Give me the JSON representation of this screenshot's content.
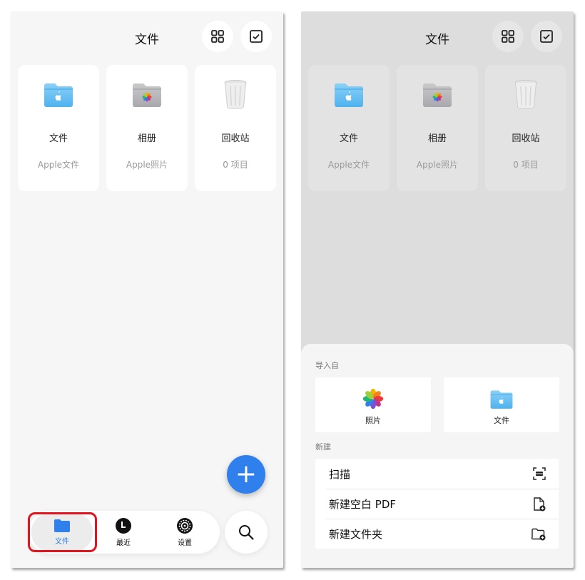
{
  "left": {
    "title": "文件",
    "cards": [
      {
        "name": "文件",
        "sub": "Apple文件",
        "icon": "blue-folder-icon"
      },
      {
        "name": "相册",
        "sub": "Apple照片",
        "icon": "photos-folder-icon"
      },
      {
        "name": "回收站",
        "sub": "0 项目",
        "icon": "trash-icon"
      }
    ],
    "fab_label": "+",
    "tabs": [
      {
        "label": "文件",
        "icon": "folder-icon"
      },
      {
        "label": "最近",
        "icon": "clock-icon"
      },
      {
        "label": "设置",
        "icon": "gear-icon"
      }
    ]
  },
  "right": {
    "title": "文件",
    "cards": [
      {
        "name": "文件",
        "sub": "Apple文件"
      },
      {
        "name": "相册",
        "sub": "Apple照片"
      },
      {
        "name": "回收站",
        "sub": "0 项目"
      }
    ],
    "sheet": {
      "import_title": "导入自",
      "imports": [
        {
          "label": "照片",
          "icon": "photos-icon"
        },
        {
          "label": "文件",
          "icon": "files-folder-icon"
        }
      ],
      "new_title": "新建",
      "actions": [
        {
          "label": "扫描",
          "icon": "scan-icon"
        },
        {
          "label": "新建空白 PDF",
          "icon": "new-pdf-icon"
        },
        {
          "label": "新建文件夹",
          "icon": "new-folder-icon"
        }
      ]
    }
  },
  "colors": {
    "accent": "#2f80ed",
    "highlight": "#e0151e"
  }
}
